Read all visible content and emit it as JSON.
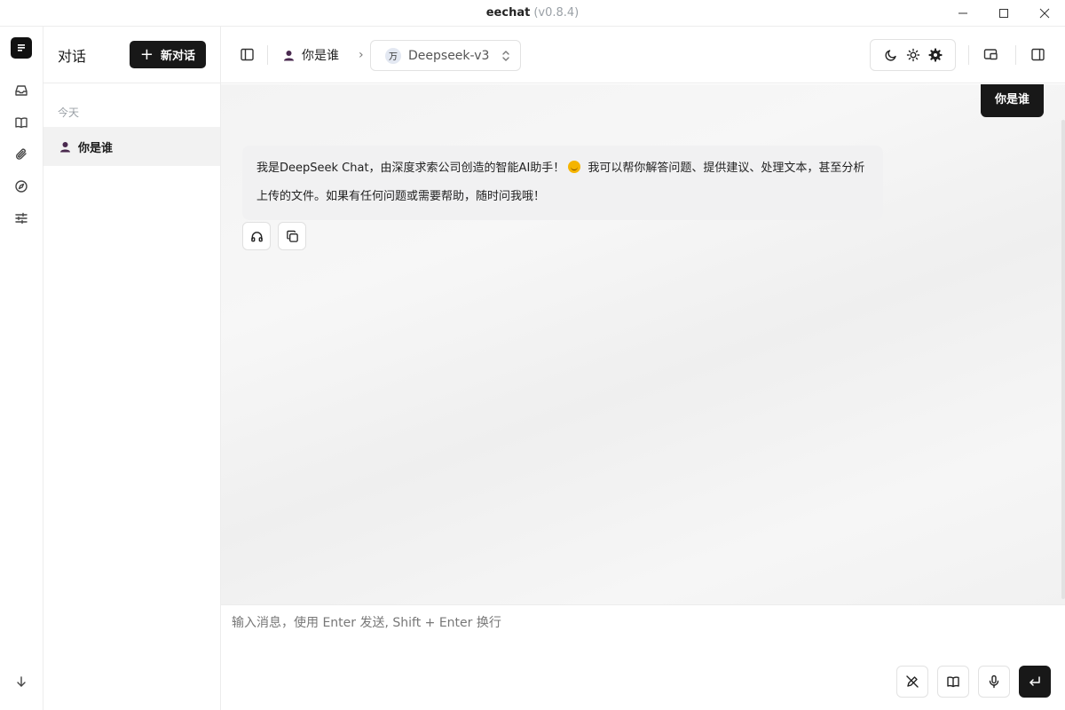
{
  "window": {
    "app_name": "eechat",
    "version": "(v0.8.4)",
    "controls": [
      "minimize-icon",
      "maximize-icon",
      "close-icon"
    ]
  },
  "rail": {
    "logo": "notes-logo-icon",
    "icons": [
      "inbox-icon",
      "book-icon",
      "paperclip-icon",
      "compass-icon",
      "sliders-icon",
      "arrow-down-icon"
    ]
  },
  "sidebar": {
    "title": "对话",
    "new_chat_label": "新对话",
    "groups": [
      {
        "label": "今天",
        "items": [
          {
            "title": "你是谁",
            "active": true
          }
        ]
      }
    ]
  },
  "topbar": {
    "breadcrumb_title": "你是谁",
    "model_avatar": "万",
    "model_name": "Deepseek-v3",
    "theme_icons": [
      "moon-icon",
      "sun-icon",
      "gear-icon"
    ],
    "right_icons": [
      "window-icon",
      "sidebar-right-icon"
    ]
  },
  "chat": {
    "user_message": "你是谁",
    "ai_message_part1": "我是DeepSeek Chat，由深度求索公司创造的智能AI助手！",
    "ai_message_part2": " 我可以帮你解答问题、提供建议、处理文本，甚至分析上传的文件。如果有任何问题或需要帮助，随时问我哦！",
    "actions": [
      "headphones-icon",
      "copy-icon"
    ]
  },
  "composer": {
    "placeholder": "输入消息，使用 Enter 发送, Shift + Enter 换行",
    "value": "",
    "tools": [
      "edit-off-icon",
      "book-icon",
      "microphone-icon",
      "send-icon"
    ]
  },
  "colors": {
    "accent_dark": "#181818",
    "user_icon": "#4a2a4f",
    "bubble_bg": "#f1f1f2"
  }
}
